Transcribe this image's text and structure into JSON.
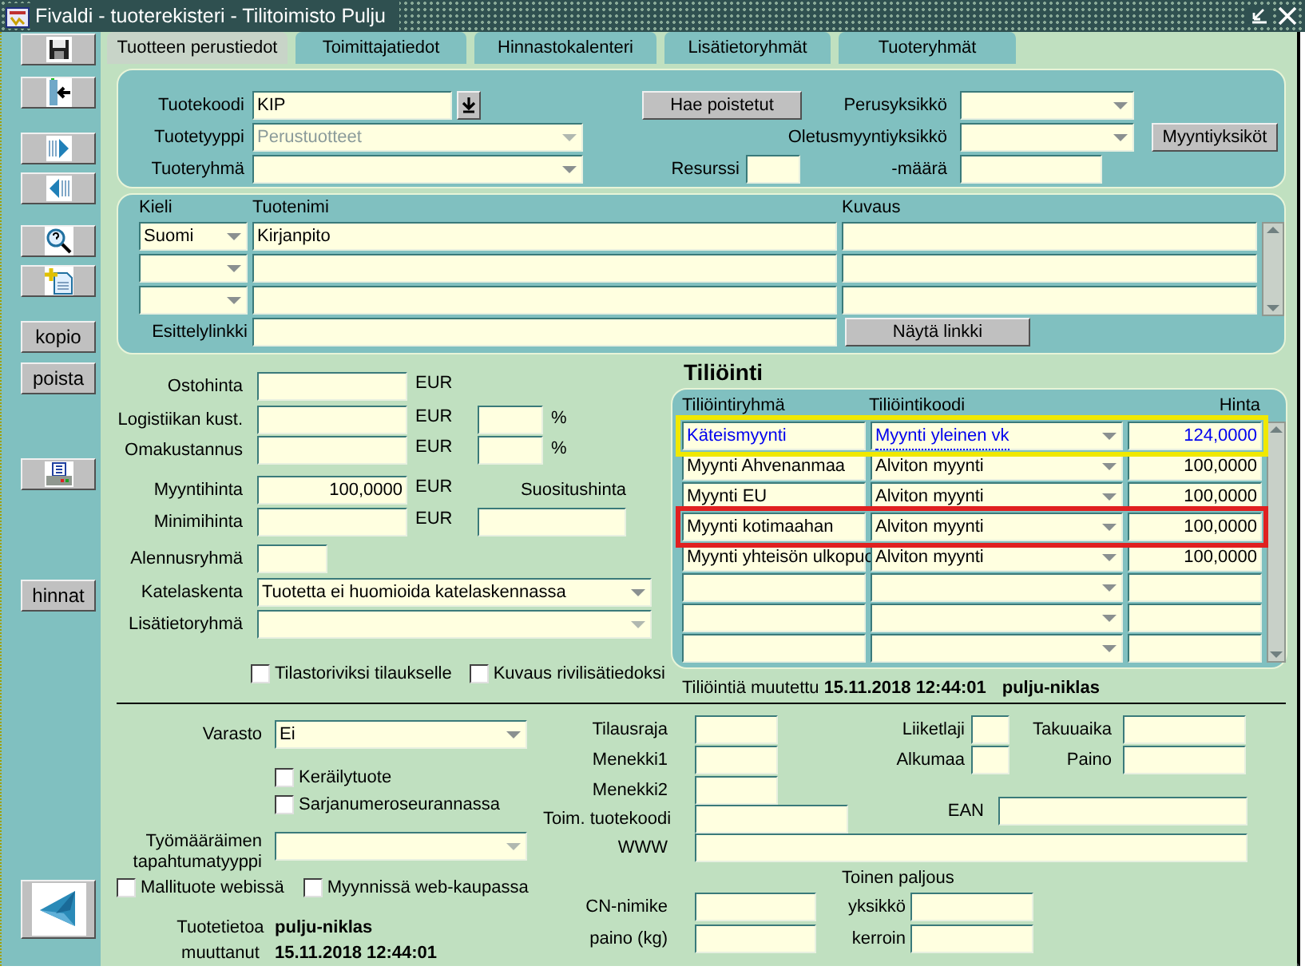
{
  "window": {
    "title": "Fivaldi - tuoterekisteri - Tilitoimisto Pulju"
  },
  "toolbar": [
    {
      "kind": "save"
    },
    {
      "kind": "exit"
    },
    {
      "kind": "next"
    },
    {
      "kind": "previous"
    },
    {
      "kind": "query"
    },
    {
      "kind": "new"
    },
    {
      "kind": "text",
      "label": "kopio"
    },
    {
      "kind": "text",
      "label": "poista"
    },
    {
      "kind": "print"
    },
    {
      "kind": "text",
      "label": "hinnat"
    },
    {
      "kind": "logo"
    }
  ],
  "tabs": [
    {
      "label": "Tuotteen perustiedot",
      "selected": true
    },
    {
      "label": "Toimittajatiedot",
      "selected": false
    },
    {
      "label": "Hinnastokalenteri",
      "selected": false
    },
    {
      "label": "Lisätietoryhmät",
      "selected": false
    },
    {
      "label": "Tuoteryhmät",
      "selected": false
    }
  ],
  "product": {
    "code": {
      "label": "Tuotekoodi",
      "value": "KIP"
    },
    "type": {
      "label": "Tuotetyyppi",
      "value": "Perustuotteet",
      "disabled": true
    },
    "group": {
      "label": "Tuoteryhmä"
    },
    "fetch_deleted_button": "Hae poistetut",
    "resource": {
      "label": "Resurssi"
    },
    "base_unit": {
      "label": "Perusyksikkö"
    },
    "default_sales_unit": {
      "label": "Oletusmyyntiyksikkö"
    },
    "amount": {
      "label": "-määrä"
    },
    "sales_units_button": "Myyntiyksiköt"
  },
  "names": {
    "columns": [
      "Kieli",
      "Tuotenimi",
      "Kuvaus"
    ],
    "rows": [
      {
        "language": "Suomi",
        "name": "Kirjanpito"
      },
      {},
      {}
    ],
    "link": {
      "label": "Esittelylinkki"
    },
    "show_link_button": "Näytä linkki"
  },
  "pricing": {
    "purchase": {
      "label": "Ostohinta",
      "unit": "EUR"
    },
    "logistics": {
      "label": "Logistiikan kust.",
      "unit": "EUR",
      "percent_unit": "%"
    },
    "own_cost": {
      "label": "Omakustannus",
      "unit": "EUR",
      "percent_unit": "%"
    },
    "sales": {
      "label": "Myyntihinta",
      "value": "100,0000",
      "unit": "EUR"
    },
    "minimum": {
      "label": "Minimihinta",
      "unit": "EUR"
    },
    "recommended": {
      "label": "Suositushinta"
    },
    "discount_group": {
      "label": "Alennusryhmä"
    },
    "margin_calc": {
      "label": "Katelaskenta",
      "value": "Tuotetta ei huomioida katelaskennassa"
    },
    "extra_group": {
      "label": "Lisätietoryhmä"
    },
    "checkboxes": [
      {
        "label": "Tilastoriviksi tilaukselle",
        "checked": false
      },
      {
        "label": "Kuvaus rivilisätiedoksi",
        "checked": false
      }
    ]
  },
  "posting": {
    "title": "Tiliöinti",
    "columns": [
      "Tiliöintiryhmä",
      "Tiliöintikoodi",
      "Hinta"
    ],
    "rows": [
      {
        "group": "Käteismyynti",
        "code": "Myynti yleinen vk",
        "price": "124,0000",
        "current": true,
        "color": "#f0e800"
      },
      {
        "group": "Myynti Ahvenanmaa",
        "code": "Alviton myynti",
        "price": "100,0000",
        "current": false
      },
      {
        "group": "Myynti EU",
        "code": "Alviton myynti",
        "price": "100,0000",
        "current": false
      },
      {
        "group": "Myynti kotimaahan",
        "code": "Alviton myynti",
        "price": "100,0000",
        "current": false,
        "color": "#e02020"
      },
      {
        "group": "Myynti yhteisön ulkopuo",
        "code": "Alviton myynti",
        "price": "100,0000",
        "current": false
      },
      {},
      {},
      {}
    ],
    "changed_label": "Tiliöintiä muutettu",
    "changed_at": "15.11.2018 12:44:01",
    "changed_by": "pulju-niklas"
  },
  "stock": {
    "warehouse": {
      "label": "Varasto",
      "value": "Ei"
    },
    "checkboxes": [
      {
        "label": "Keräilytuote",
        "checked": false
      },
      {
        "label": "Sarjanumeroseurannassa",
        "checked": false
      }
    ],
    "work_order_type": {
      "label": "Työmääräimen tapahtumatyyppi"
    },
    "web_checkboxes": [
      {
        "label": "Mallituote webissä",
        "checked": false
      },
      {
        "label": "Myynnissä web-kaupassa",
        "checked": false
      }
    ],
    "modified": {
      "label": "Tuotetietoa muuttanut",
      "by": "pulju-niklas",
      "at": "15.11.2018 12:44:01"
    }
  },
  "details": {
    "order_limit": {
      "label": "Tilausraja"
    },
    "usage1": {
      "label": "Menekki1"
    },
    "usage2": {
      "label": "Menekki2"
    },
    "supplier_code": {
      "label": "Toim. tuotekoodi"
    },
    "www": {
      "label": "WWW"
    },
    "cn_code": {
      "label": "CN-nimike"
    },
    "weight_kg": {
      "label": "paino (kg)"
    },
    "transaction_type": {
      "label": "Liiketlaji"
    },
    "origin": {
      "label": "Alkumaa"
    },
    "warranty": {
      "label": "Takuuaika"
    },
    "weight": {
      "label": "Paino"
    },
    "ean": {
      "label": "EAN"
    },
    "second_quantity": {
      "title": "Toinen paljous",
      "unit": {
        "label": "yksikkö"
      },
      "factor": {
        "label": "kerroin"
      }
    }
  }
}
